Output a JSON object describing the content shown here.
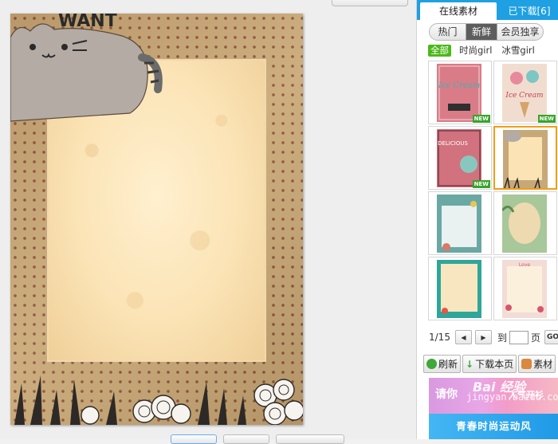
{
  "sidebar": {
    "tabs": {
      "online": "在线素材",
      "downloaded": "已下载[6]"
    },
    "segments": [
      "热门",
      "新鲜",
      "会员独享"
    ],
    "filters": [
      "全部",
      "时尚girl",
      "冰雪girl"
    ],
    "thumbs": [
      {
        "title": "Ice Cream",
        "badge": "NEW"
      },
      {
        "title": "Ice Cream",
        "badge": "NEW"
      },
      {
        "title": "DELICIOUS",
        "badge": "NEW"
      },
      {
        "title": "",
        "badge": ""
      },
      {
        "title": "",
        "badge": ""
      },
      {
        "title": "",
        "badge": ""
      },
      {
        "title": "",
        "badge": ""
      },
      {
        "title": "Love",
        "badge": ""
      }
    ],
    "pager": {
      "current": "1/15",
      "goto_label": "到",
      "page_label": "页",
      "go": "GO"
    },
    "actions": {
      "refresh": "刷新",
      "download_page": "下载本页",
      "material": "素材"
    },
    "banner": {
      "line1": "请你",
      "line2": "人气开衫",
      "bottom": "青春时尚运动风"
    }
  },
  "poster": {
    "title_fragment": "WANT"
  },
  "watermark": {
    "logo": "Bai 经验",
    "url": "jingyan.baidu.com"
  },
  "colors": {
    "tab_blue": "#1ea0e2",
    "filter_green": "#4cb81a",
    "selected_orange": "#f39c12"
  }
}
